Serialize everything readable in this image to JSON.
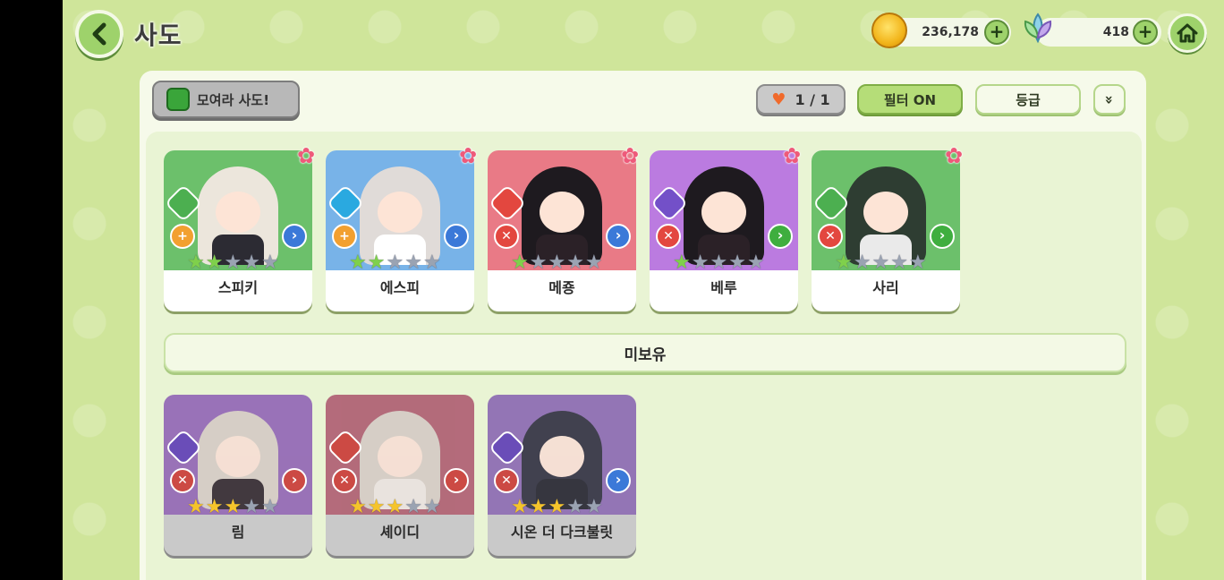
{
  "header": {
    "title": "사도",
    "gold": "236,178",
    "gems": "418",
    "plus_symbol": "+"
  },
  "toolbar": {
    "gather_label": "모여라 사도!",
    "heart_count": "1 / 1",
    "filter_label": "필터 ON",
    "grade_label": "등급",
    "sort_symbol": "»"
  },
  "owned": [
    {
      "name": "스피키",
      "bg": "#6cc06b",
      "hair": "#ece6dc",
      "body": "#2c2b33",
      "element": "#4caf50",
      "role": "#f2a030",
      "role_symbol": "+",
      "pos": "#3b79d8",
      "stars_on": 2
    },
    {
      "name": "에스피",
      "bg": "#78b3e8",
      "hair": "#e0dbd8",
      "body": "#ffffff",
      "element": "#2aa9e0",
      "role": "#f2a030",
      "role_symbol": "+",
      "pos": "#3b79d8",
      "stars_on": 2
    },
    {
      "name": "메죵",
      "bg": "#e97a86",
      "hair": "#1e1a1f",
      "body": "#2b2127",
      "element": "#e3473f",
      "role": "#e3473f",
      "role_symbol": "✕",
      "pos": "#3b79d8",
      "stars_on": 1
    },
    {
      "name": "베루",
      "bg": "#bb7be0",
      "hair": "#1e1a1f",
      "body": "#2b2127",
      "element": "#7350c8",
      "role": "#e3473f",
      "role_symbol": "✕",
      "pos": "#3fae3f",
      "stars_on": 1
    },
    {
      "name": "사리",
      "bg": "#6cc06b",
      "hair": "#2e3d32",
      "body": "#eaeaea",
      "element": "#4caf50",
      "role": "#e3473f",
      "role_symbol": "✕",
      "pos": "#3fae3f",
      "stars_on": 1
    }
  ],
  "unowned_header": "미보유",
  "unowned": [
    {
      "name": "림",
      "bg": "#9163b5",
      "hair": "#d9cfc6",
      "body": "#2b2127",
      "element": "#6a4db8",
      "role": "#cc4a44",
      "role_symbol": "✕",
      "pos": "#cc4a44",
      "stars_on": 3
    },
    {
      "name": "셰이디",
      "bg": "#b05b6d",
      "hair": "#d9cfc6",
      "body": "#efe8e2",
      "element": "#cc4a44",
      "role": "#cc4a44",
      "role_symbol": "✕",
      "pos": "#cc4a44",
      "stars_on": 3
    },
    {
      "name": "시온 더 다크불릿",
      "bg": "#8a67b2",
      "hair": "#2a2a3a",
      "body": "#1d1d28",
      "element": "#6a4db8",
      "role": "#cc4a44",
      "role_symbol": "✕",
      "pos": "#3b79d8",
      "stars_on": 3
    }
  ]
}
